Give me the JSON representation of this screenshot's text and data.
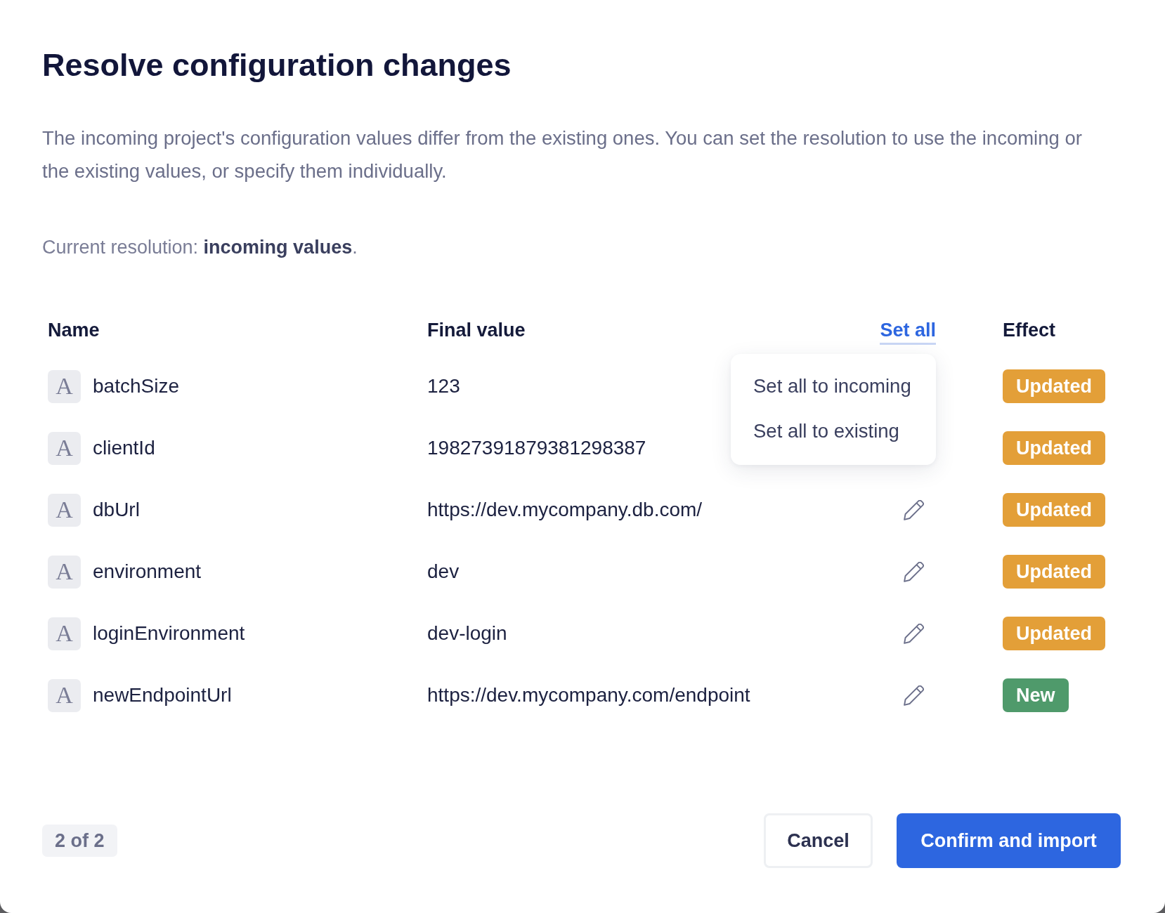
{
  "dialog": {
    "title": "Resolve configuration changes",
    "description": "The incoming project's configuration values differ from the existing ones. You can set the resolution to use the incoming or the existing values, or specify them individually.",
    "current_resolution": "Current resolution: **incoming values**."
  },
  "table": {
    "columns": [
      {
        "kind": "heading",
        "label": "Name"
      },
      {
        "kind": "heading",
        "label": "Final value"
      },
      {
        "kind": "menu",
        "label": "Set all",
        "expanded": true,
        "menu": [
          {
            "label": "Set all to incoming"
          },
          {
            "label": "Set all to existing"
          }
        ]
      },
      {
        "kind": "heading",
        "label": "Effect"
      }
    ],
    "rows": [
      {
        "type_icon": "A",
        "name": "batchSize",
        "value": "123",
        "effect": {
          "label": "Updated",
          "color": "#e39f38"
        }
      },
      {
        "type_icon": "A",
        "name": "clientId",
        "value": "19827391879381298387",
        "effect": {
          "label": "Updated",
          "color": "#e39f38"
        }
      },
      {
        "type_icon": "A",
        "name": "dbUrl",
        "value": "https://dev.mycompany.db.com/",
        "effect": {
          "label": "Updated",
          "color": "#e39f38"
        }
      },
      {
        "type_icon": "A",
        "name": "environment",
        "value": "dev",
        "effect": {
          "label": "Updated",
          "color": "#e39f38"
        }
      },
      {
        "type_icon": "A",
        "name": "loginEnvironment",
        "value": "dev-login",
        "effect": {
          "label": "Updated",
          "color": "#e39f38"
        }
      },
      {
        "type_icon": "A",
        "name": "newEndpointUrl",
        "value": "https://dev.mycompany.com/endpoint",
        "effect": {
          "label": "New",
          "color": "#4f9a6b"
        }
      }
    ]
  },
  "footer": {
    "page": "2 of 2",
    "buttons": [
      {
        "label": "Cancel",
        "kind": "secondary"
      },
      {
        "label": "Confirm and import",
        "kind": "primary"
      }
    ]
  }
}
